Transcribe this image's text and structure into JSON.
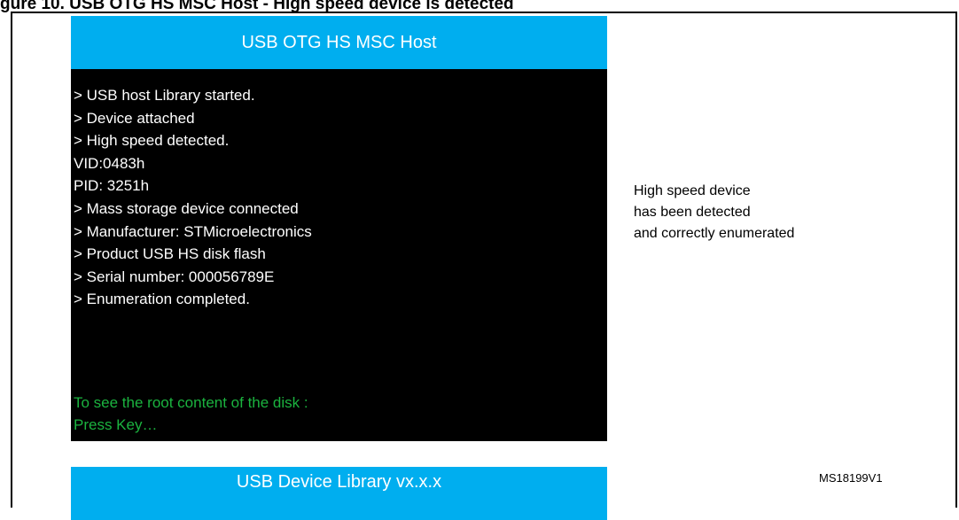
{
  "figure": {
    "title": "gure 10. USB OTG HS MSC Host - High speed device is detected"
  },
  "header": {
    "title": "USB OTG HS MSC Host"
  },
  "log_lines": [
    "> USB host Library started.",
    "> Device attached",
    "> High speed detected.",
    "VID:0483h",
    "PID: 3251h",
    "> Mass storage device connected",
    "> Manufacturer: STMicroelectronics",
    "> Product USB HS disk flash",
    "> Serial number: 000056789E",
    "> Enumeration completed."
  ],
  "prompt": {
    "line1": "To see the root content of the disk :",
    "line2": "Press Key…"
  },
  "footer": {
    "label": "USB Device Library vx.x.x"
  },
  "side_note": {
    "line1": "High speed device",
    "line2": "has been detected",
    "line3": "and correctly enumerated"
  },
  "reference": "MS18199V1",
  "colors": {
    "bar": "#00aeef",
    "screen": "#000000",
    "log_text": "#ffffff",
    "prompt_text": "#1bb33f"
  }
}
